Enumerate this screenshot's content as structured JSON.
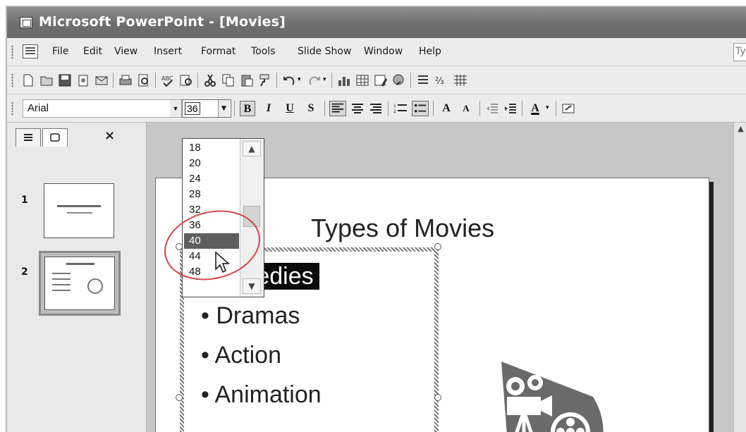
{
  "window": {
    "title": "Microsoft PowerPoint - [Movies]"
  },
  "menubar": {
    "items": [
      "File",
      "Edit",
      "View",
      "Insert",
      "Format",
      "Tools",
      "Slide Show",
      "Window",
      "Help"
    ],
    "help_box_text": "Ty"
  },
  "standard_toolbar": {
    "icons": [
      "new-icon",
      "open-icon",
      "save-icon",
      "permission-icon",
      "email-icon",
      "print-icon",
      "print-preview-icon",
      "spelling-icon",
      "research-icon",
      "cut-icon",
      "copy-icon",
      "paste-icon",
      "format-painter-icon",
      "undo-icon",
      "redo-icon",
      "insert-chart-icon",
      "insert-table-icon",
      "tables-borders-icon",
      "insert-hyperlink-icon",
      "expand-all-icon",
      "show-formatting-icon",
      "grid-icon"
    ]
  },
  "formatting_toolbar": {
    "font_name": "Arial",
    "font_size": "36",
    "bold_label": "B",
    "italic_label": "I",
    "underline_label": "U",
    "shadow_label": "S",
    "increase_font_label": "A",
    "decrease_font_label": "A",
    "font_color_label": "A"
  },
  "font_size_dropdown": {
    "options": [
      "18",
      "20",
      "24",
      "28",
      "32",
      "36",
      "40",
      "44",
      "48"
    ],
    "highlighted": "40"
  },
  "left_pane": {
    "close_label": "×",
    "slides": [
      {
        "number": "1"
      },
      {
        "number": "2"
      }
    ]
  },
  "slide": {
    "title": "Types of Movies",
    "bullets": [
      "Comedies",
      "Dramas",
      "Action",
      "Animation"
    ],
    "highlighted_bullet_visible_text": "medies"
  },
  "colors": {
    "title_bar": "#6e6e6e",
    "selection": "#5e5e5e",
    "annotation_circle": "#d34545",
    "editing_area": "#c7c7c7"
  }
}
